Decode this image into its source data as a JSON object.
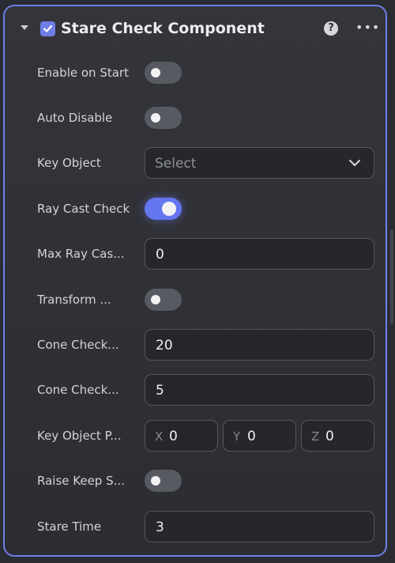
{
  "component": {
    "title": "Stare Check Component",
    "enabled": true,
    "help_icon": "question-icon",
    "more_icon": "more-dots-icon"
  },
  "accent_color": "#6476ef",
  "properties": {
    "enable_on_start": {
      "label": "Enable on Start",
      "on": false
    },
    "auto_disable": {
      "label": "Auto Disable",
      "on": false
    },
    "key_object": {
      "label": "Key Object",
      "placeholder": "Select"
    },
    "ray_cast_check": {
      "label": "Ray Cast Check",
      "on": true
    },
    "max_ray_cast": {
      "label": "Max Ray Cas...",
      "value": "0"
    },
    "transform": {
      "label": "Transform ...",
      "on": false
    },
    "cone_check_1": {
      "label": "Cone Check...",
      "value": "20"
    },
    "cone_check_2": {
      "label": "Cone Check...",
      "value": "5"
    },
    "key_object_pos": {
      "label": "Key Object P...",
      "x_label": "X",
      "x": "0",
      "y_label": "Y",
      "y": "0",
      "z_label": "Z",
      "z": "0"
    },
    "raise_keep": {
      "label": "Raise Keep S...",
      "on": false
    },
    "stare_time": {
      "label": "Stare Time",
      "value": "3"
    }
  }
}
